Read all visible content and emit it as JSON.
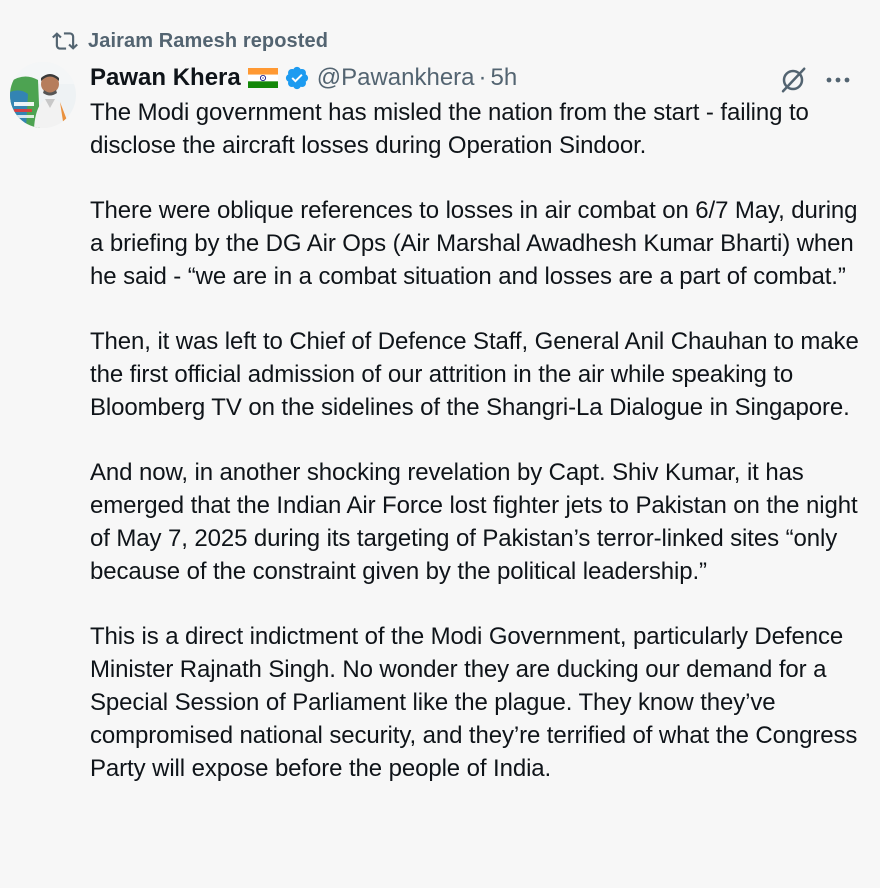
{
  "repost": {
    "text": "Jairam Ramesh reposted",
    "icon": "repost-icon"
  },
  "author": {
    "name": "Pawan Khera",
    "handle": "@Pawankhera",
    "time": "5h",
    "separator": "·",
    "flag_icon": "india-flag-icon",
    "verified_icon": "verified-badge-icon",
    "verified_color": "#1d9bf0"
  },
  "actions": {
    "grok_icon": "grok-icon",
    "more_icon": "more-icon"
  },
  "tweet": {
    "paragraphs": [
      "The Modi government has misled the nation from the start - failing to disclose the aircraft losses during Operation Sindoor.",
      "There were oblique references to losses in air combat on 6/7 May, during a briefing by the DG Air Ops (Air Marshal Awadhesh Kumar Bharti) when he said - “we are in a combat situation and losses are a part of combat.”",
      "Then, it was left to Chief of Defence Staff, General Anil Chauhan to make the first official admission of our attrition in the air while speaking to Bloomberg TV on the sidelines of the Shangri-La Dialogue in Singapore.",
      "And now, in another shocking revelation by Capt. Shiv Kumar, it has emerged that the Indian Air Force lost fighter jets to Pakistan on the night of May 7, 2025 during its targeting of Pakistan’s terror-linked sites “only because of the constraint given by the political leadership.”",
      "This is a direct indictment of the Modi Government, particularly Defence Minister Rajnath Singh. No wonder they are ducking our demand for a Special Session of Parliament like the plague. They know they’ve compromised national security, and they’re terrified of what the Congress Party will expose before the people of India."
    ]
  },
  "colors": {
    "text_primary": "#0f1419",
    "text_secondary": "#536471",
    "accent": "#1d9bf0",
    "background": "#f7f7f7"
  }
}
